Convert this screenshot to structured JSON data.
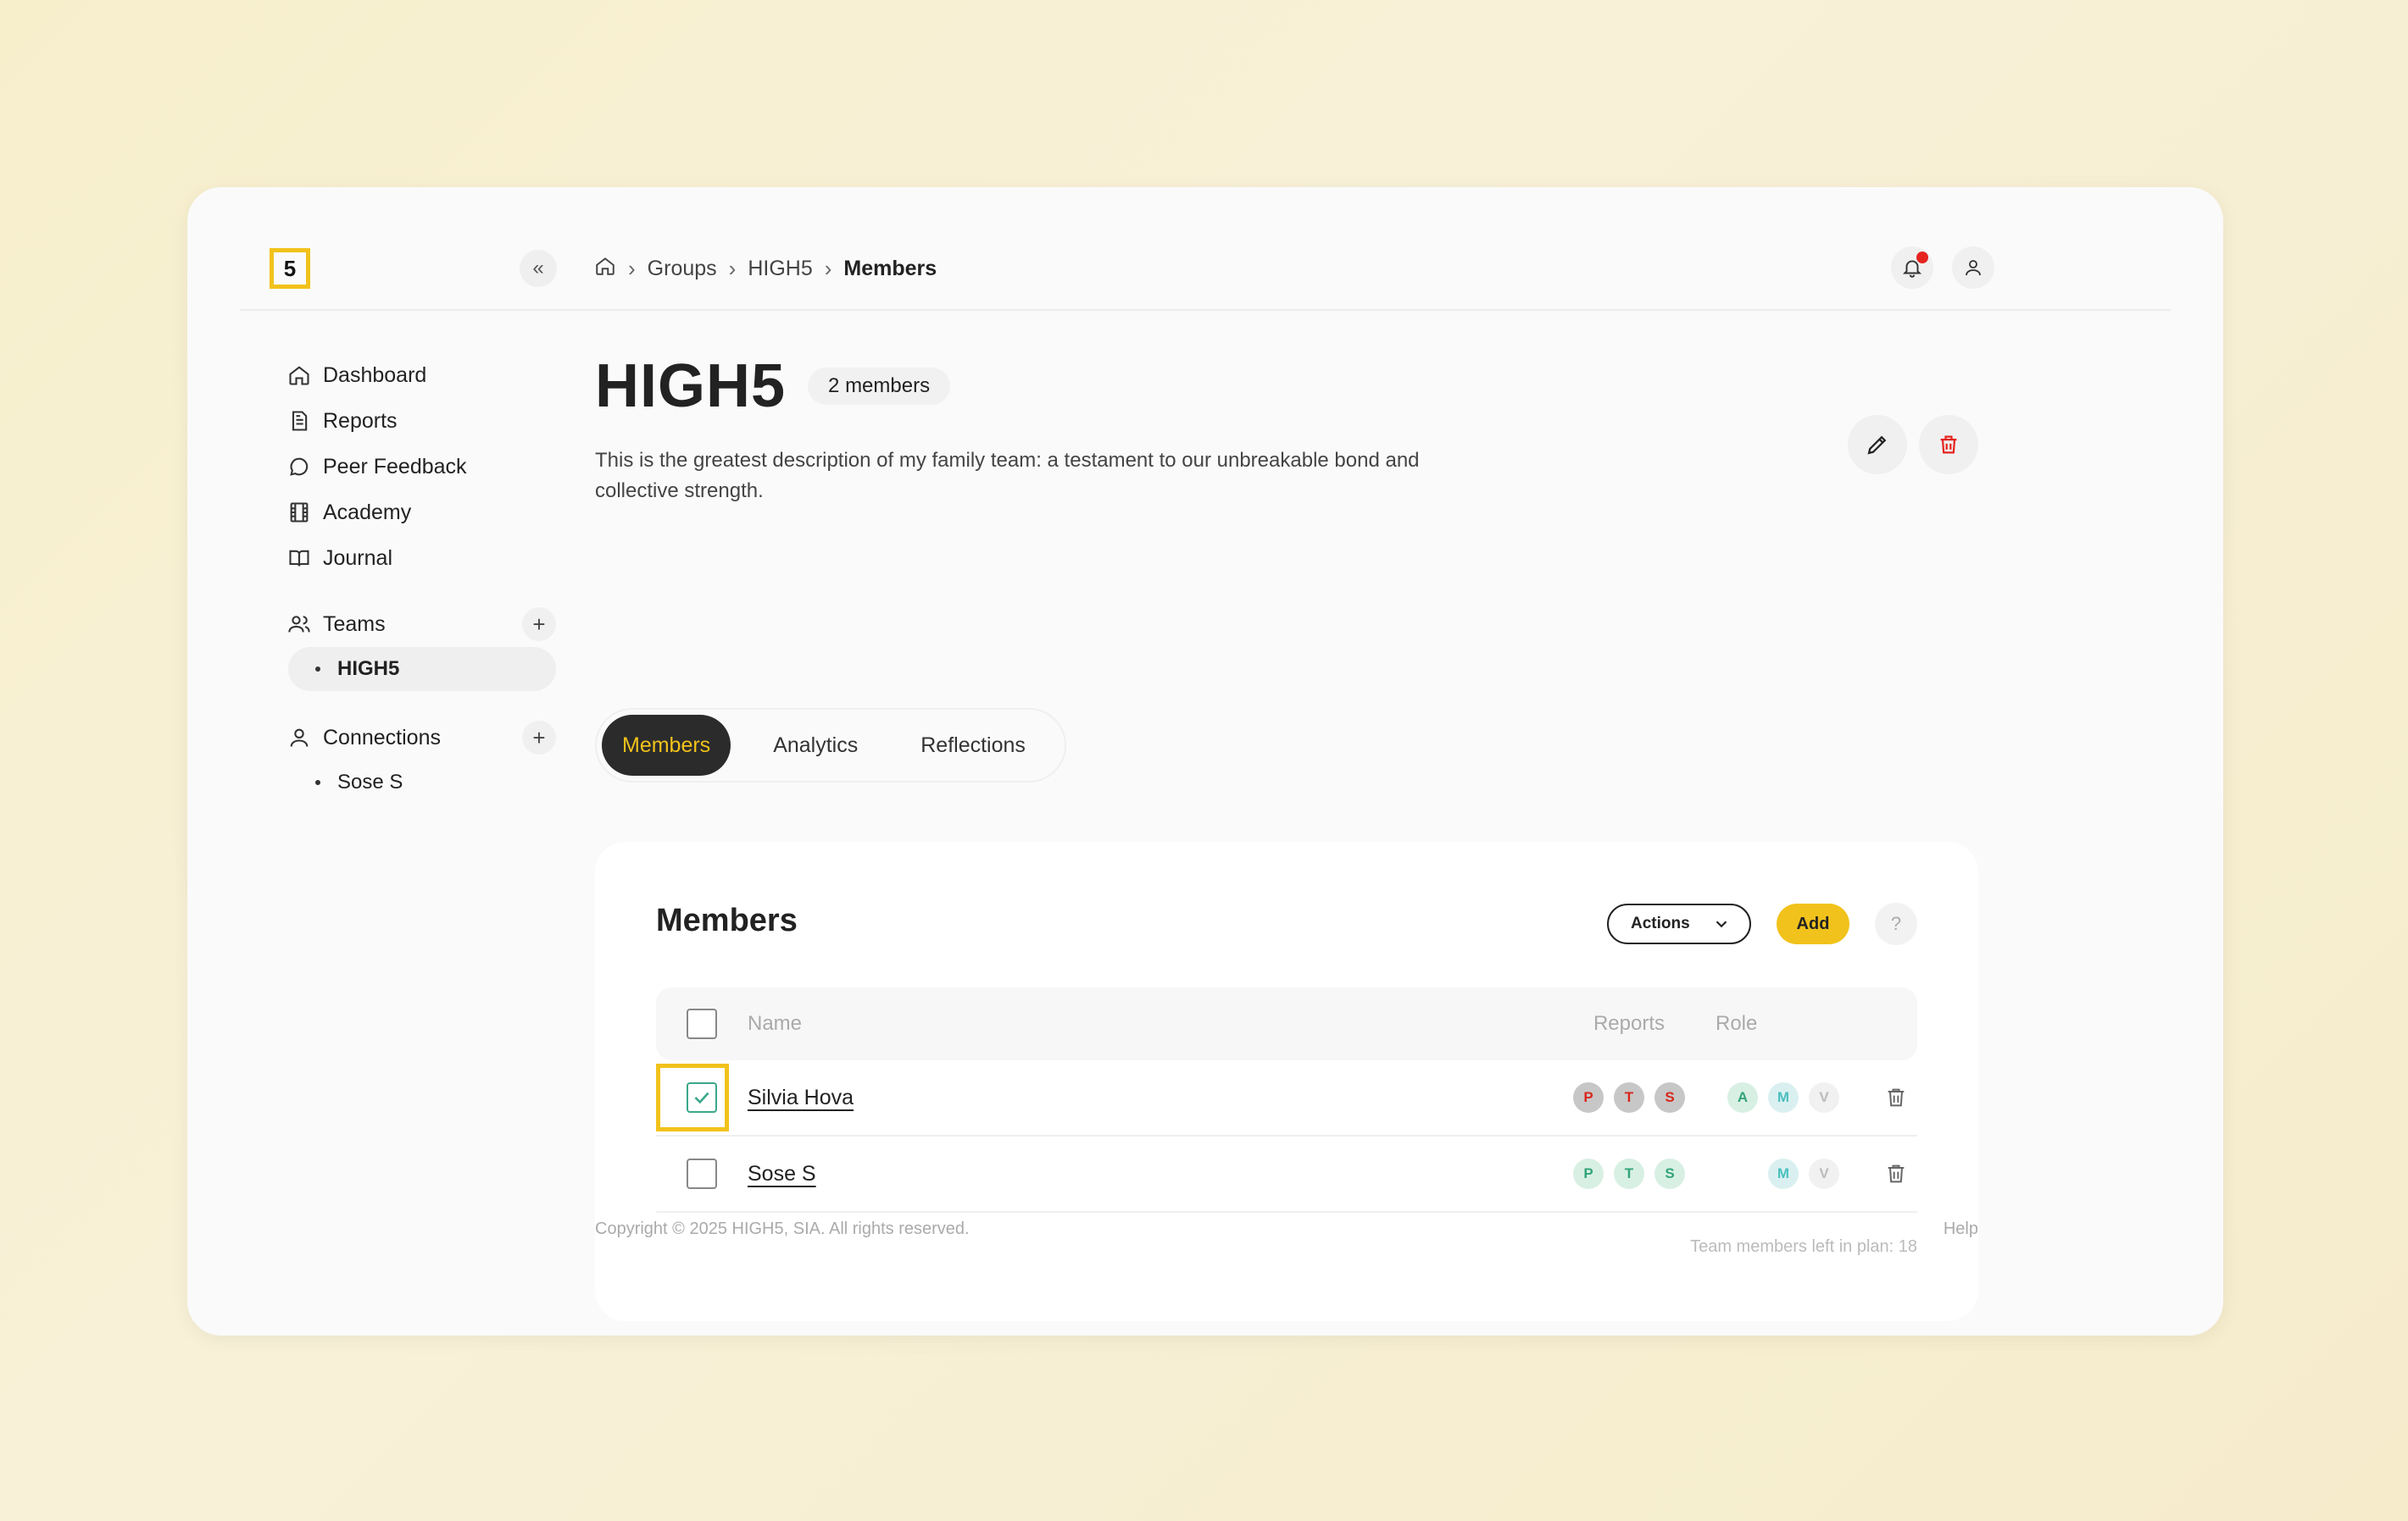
{
  "brand": {
    "logo_text": "5",
    "accent": "#f1c21b"
  },
  "topbar": {
    "collapse_label": "«",
    "breadcrumb": [
      "Groups",
      "HIGH5",
      "Members"
    ]
  },
  "sidebar": {
    "nav": [
      {
        "label": "Dashboard",
        "icon": "home-icon"
      },
      {
        "label": "Reports",
        "icon": "document-icon"
      },
      {
        "label": "Peer Feedback",
        "icon": "chat-icon"
      },
      {
        "label": "Academy",
        "icon": "film-icon"
      },
      {
        "label": "Journal",
        "icon": "book-icon"
      }
    ],
    "teams": {
      "label": "Teams",
      "items": [
        "HIGH5"
      ]
    },
    "connections": {
      "label": "Connections",
      "items": [
        "Sose S"
      ]
    }
  },
  "group": {
    "title": "HIGH5",
    "member_count": "2 members",
    "description": "This is the greatest description of my family team: a testament to our unbreakable bond and collective strength."
  },
  "tabs": [
    "Members",
    "Analytics",
    "Reflections"
  ],
  "members_card": {
    "title": "Members",
    "actions_label": "Actions",
    "add_label": "Add",
    "help_label": "?",
    "columns": {
      "name": "Name",
      "reports": "Reports",
      "role": "Role"
    },
    "rows": [
      {
        "name": "Silvia Hova",
        "checked": true,
        "reports": [
          "P",
          "T",
          "S"
        ],
        "roles": [
          "A",
          "M",
          "V"
        ]
      },
      {
        "name": "Sose S",
        "checked": false,
        "reports": [
          "P",
          "T",
          "S"
        ],
        "roles": [
          "M",
          "V"
        ]
      }
    ],
    "footnote": "Team members left in plan: 18"
  },
  "footer": {
    "copyright": "Copyright © 2025 HIGH5, SIA. All rights reserved.",
    "help": "Help"
  }
}
